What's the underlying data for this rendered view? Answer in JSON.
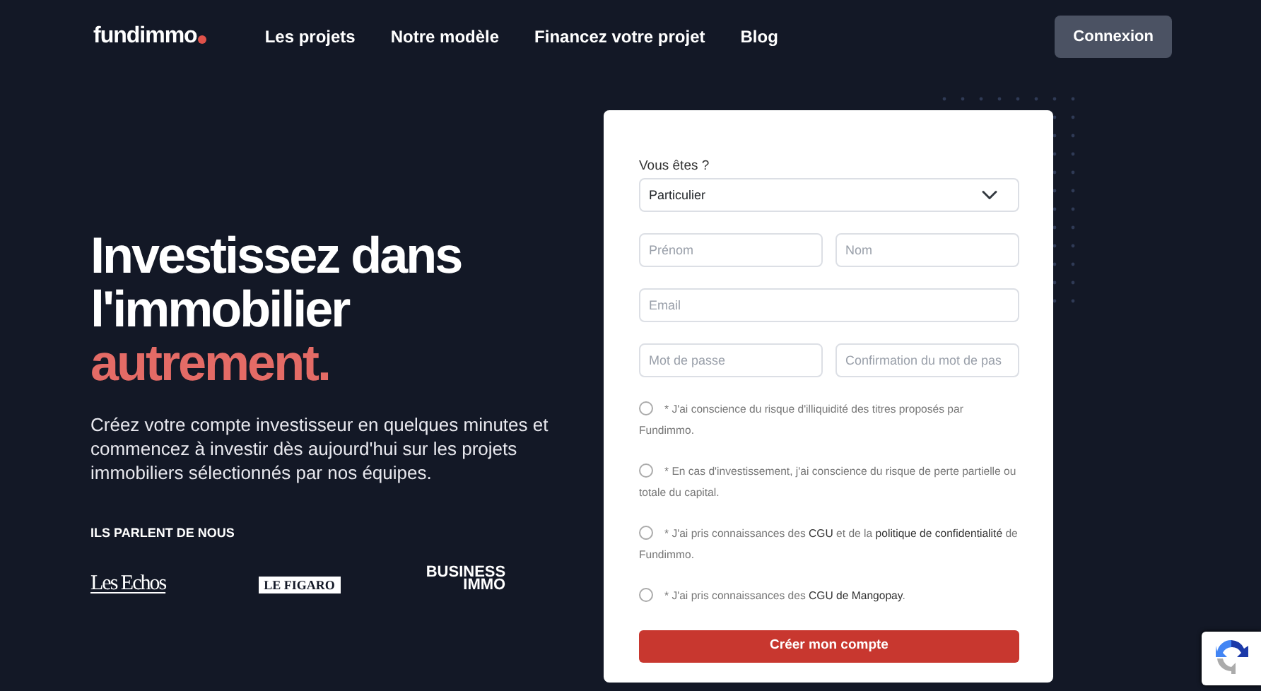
{
  "navbar": {
    "logo": "fundimmo",
    "links": [
      "Les projets",
      "Notre modèle",
      "Financez votre projet",
      "Blog"
    ],
    "login_button": "Connexion"
  },
  "hero": {
    "title_lines": [
      "Investissez dans",
      "l'immobilier"
    ],
    "title_accent": "autrement.",
    "subtitle": "Créez votre compte investisseur en quelques minutes et commencez à investir dès aujourd'hui sur les projets immobiliers sélectionnés par nos équipes.",
    "press_heading": "ILS PARLENT DE NOUS",
    "press_logos": [
      {
        "kind": "serif",
        "text": "Les Echos"
      },
      {
        "kind": "boxed",
        "text": "LE FIGARO"
      },
      {
        "kind": "stacked",
        "text": "BUSINESS",
        "subtext": "IMMO"
      }
    ]
  },
  "form": {
    "select_label": "Vous êtes ?",
    "select_value": "Particulier",
    "fields": [
      [
        {
          "placeholder": "Prénom"
        },
        {
          "placeholder": "Nom"
        }
      ],
      [
        {
          "placeholder": "Email"
        }
      ],
      [
        {
          "placeholder": "Mot de passe"
        },
        {
          "placeholder": "Confirmation du mot de pas"
        }
      ]
    ],
    "consents": [
      {
        "text": "* J'ai conscience du risque d'illiquidité des titres proposés par Fundimmo.",
        "checked": false
      },
      {
        "text": "* En cas d'investissement, j'ai conscience du risque de perte partielle ou totale du capital.",
        "checked": false
      },
      {
        "text": "* J'ai pris connaissances des **CGU** et de la **politique de confidentialité** de Fundimmo.",
        "checked": false
      },
      {
        "text": "* J'ai pris connaissances des **CGU de Mangopay**.",
        "checked": false
      }
    ],
    "submit": "Créer mon compte"
  }
}
